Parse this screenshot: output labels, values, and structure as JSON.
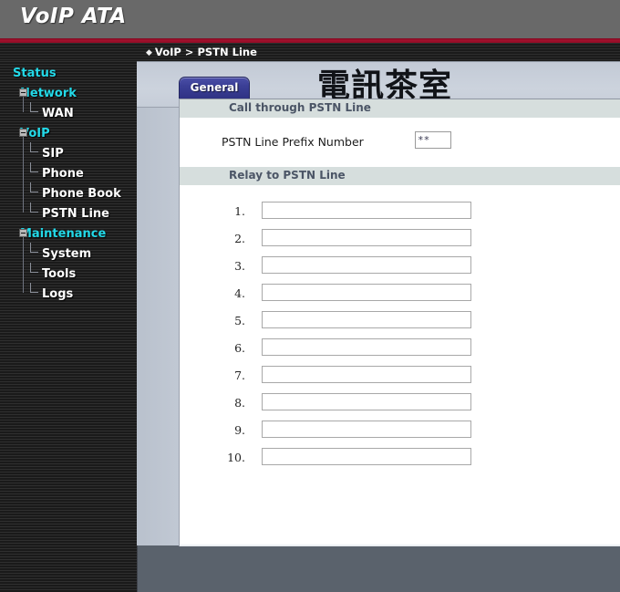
{
  "brand": {
    "title": "VoIP ATA"
  },
  "breadcrumb": {
    "diamond": "◆",
    "text": "VoIP > PSTN Line"
  },
  "sidebar": {
    "items": [
      {
        "label": "Status",
        "level": 0,
        "expander": false
      },
      {
        "label": "Network",
        "level": 1,
        "expander": true
      },
      {
        "label": "WAN",
        "level": 2,
        "expander": false
      },
      {
        "label": "VoIP",
        "level": 1,
        "expander": true
      },
      {
        "label": "SIP",
        "level": 2,
        "expander": false
      },
      {
        "label": "Phone",
        "level": 2,
        "expander": false
      },
      {
        "label": "Phone Book",
        "level": 2,
        "expander": false
      },
      {
        "label": "PSTN Line",
        "level": 2,
        "expander": false
      },
      {
        "label": "Maintenance",
        "level": 1,
        "expander": true
      },
      {
        "label": "System",
        "level": 2,
        "expander": false
      },
      {
        "label": "Tools",
        "level": 2,
        "expander": false
      },
      {
        "label": "Logs",
        "level": 2,
        "expander": false
      }
    ]
  },
  "main": {
    "tab_label": "General",
    "watermark": "電訊茶室",
    "section_call": "Call through PSTN Line",
    "prefix_label": "PSTN Line Prefix Number",
    "prefix_value": "**",
    "prefix_placeholder": "",
    "section_relay": "Relay to PSTN Line",
    "relay_rows": [
      {
        "num": "1.",
        "value": ""
      },
      {
        "num": "2.",
        "value": ""
      },
      {
        "num": "3.",
        "value": ""
      },
      {
        "num": "4.",
        "value": ""
      },
      {
        "num": "5.",
        "value": ""
      },
      {
        "num": "6.",
        "value": ""
      },
      {
        "num": "7.",
        "value": ""
      },
      {
        "num": "8.",
        "value": ""
      },
      {
        "num": "9.",
        "value": ""
      },
      {
        "num": "10.",
        "value": ""
      }
    ]
  },
  "colors": {
    "brand_bar": "#696969",
    "accent_red": "#a3102c",
    "nav_highlight": "#23d9e8",
    "tab_blue": "#3b3f96",
    "section_bar": "#d6dedd",
    "page_backdrop": "#5a626c"
  }
}
